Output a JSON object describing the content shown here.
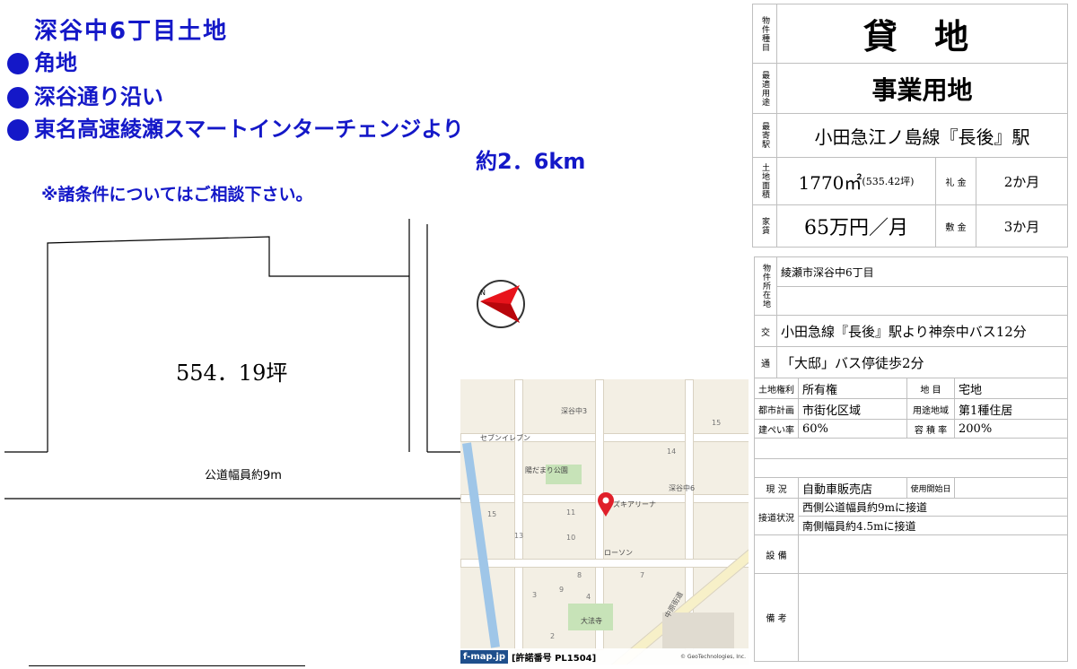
{
  "header": {
    "title": "深谷中6丁目土地",
    "bullets": [
      "角地",
      "深谷通り沿い",
      "東名高速綾瀬スマートインターチェンジより"
    ],
    "distance": "約2．6km",
    "note": "※諸条件についてはご相談下さい。"
  },
  "plot": {
    "area_label": "554．19坪",
    "road_label": "公道幅員約9m",
    "compass_letter": "N"
  },
  "map": {
    "places": [
      "深谷中3",
      "セブンイレブン",
      "陽だまり公園",
      "深谷中6",
      "ズキアリーナ",
      "ローソン",
      "大法寺",
      "中原街道"
    ],
    "blocks": [
      "15",
      "11",
      "10",
      "13",
      "15",
      "14",
      "7",
      "8",
      "9",
      "4",
      "3",
      "2"
    ],
    "footer_logo": "f-map.jp",
    "footer_permit": "[許諾番号 PL1504]",
    "footer_copy": "© GeoTechnologies, Inc."
  },
  "summary": {
    "type_label": "物件種目",
    "type_value": "貸 地",
    "use_label": "最適用途",
    "use_value": "事業用地",
    "station_label": "最寄駅",
    "station_value": "小田急江ノ島線『長後』駅",
    "area_label": "土地面積",
    "area_value": "1770㎡",
    "area_tsubo": "(535.42坪)",
    "key_money_label": "礼 金",
    "key_money_value": "2か月",
    "rent_label": "家賃",
    "rent_value": "65万円／月",
    "deposit_label": "敷 金",
    "deposit_value": "3か月"
  },
  "details": {
    "location_label": "物件所在地",
    "location_value": "綾瀬市深谷中6丁目",
    "transport_label_top": "交",
    "transport_label_bottom": "通",
    "transport_1": "小田急線『長後』駅より神奈中バス12分",
    "transport_2": "「大邸」バス停徒歩2分",
    "rights_label": "土地権利",
    "rights_value": "所有権",
    "land_label": "地 目",
    "land_value": "宅地",
    "planning_label": "都市計画",
    "planning_value": "市街化区域",
    "zoning_label": "用途地域",
    "zoning_value": "第1種住居",
    "coverage_label": "建ぺい率",
    "coverage_value": "60%",
    "far_label": "容 積 率",
    "far_value": "200%",
    "current_label": "現 況",
    "current_value": "自動車販売店",
    "start_label": "使用開始日",
    "start_value": "",
    "access_label": "接道状況",
    "access_1": "西側公道幅員約9mに接道",
    "access_2": "南側幅員約4.5mに接道",
    "facilities_label": "設 備",
    "remarks_label": "備 考"
  },
  "colors": {
    "accent": "#1418c8",
    "compass_red": "#e8141c",
    "map_pin": "#e0202a"
  }
}
